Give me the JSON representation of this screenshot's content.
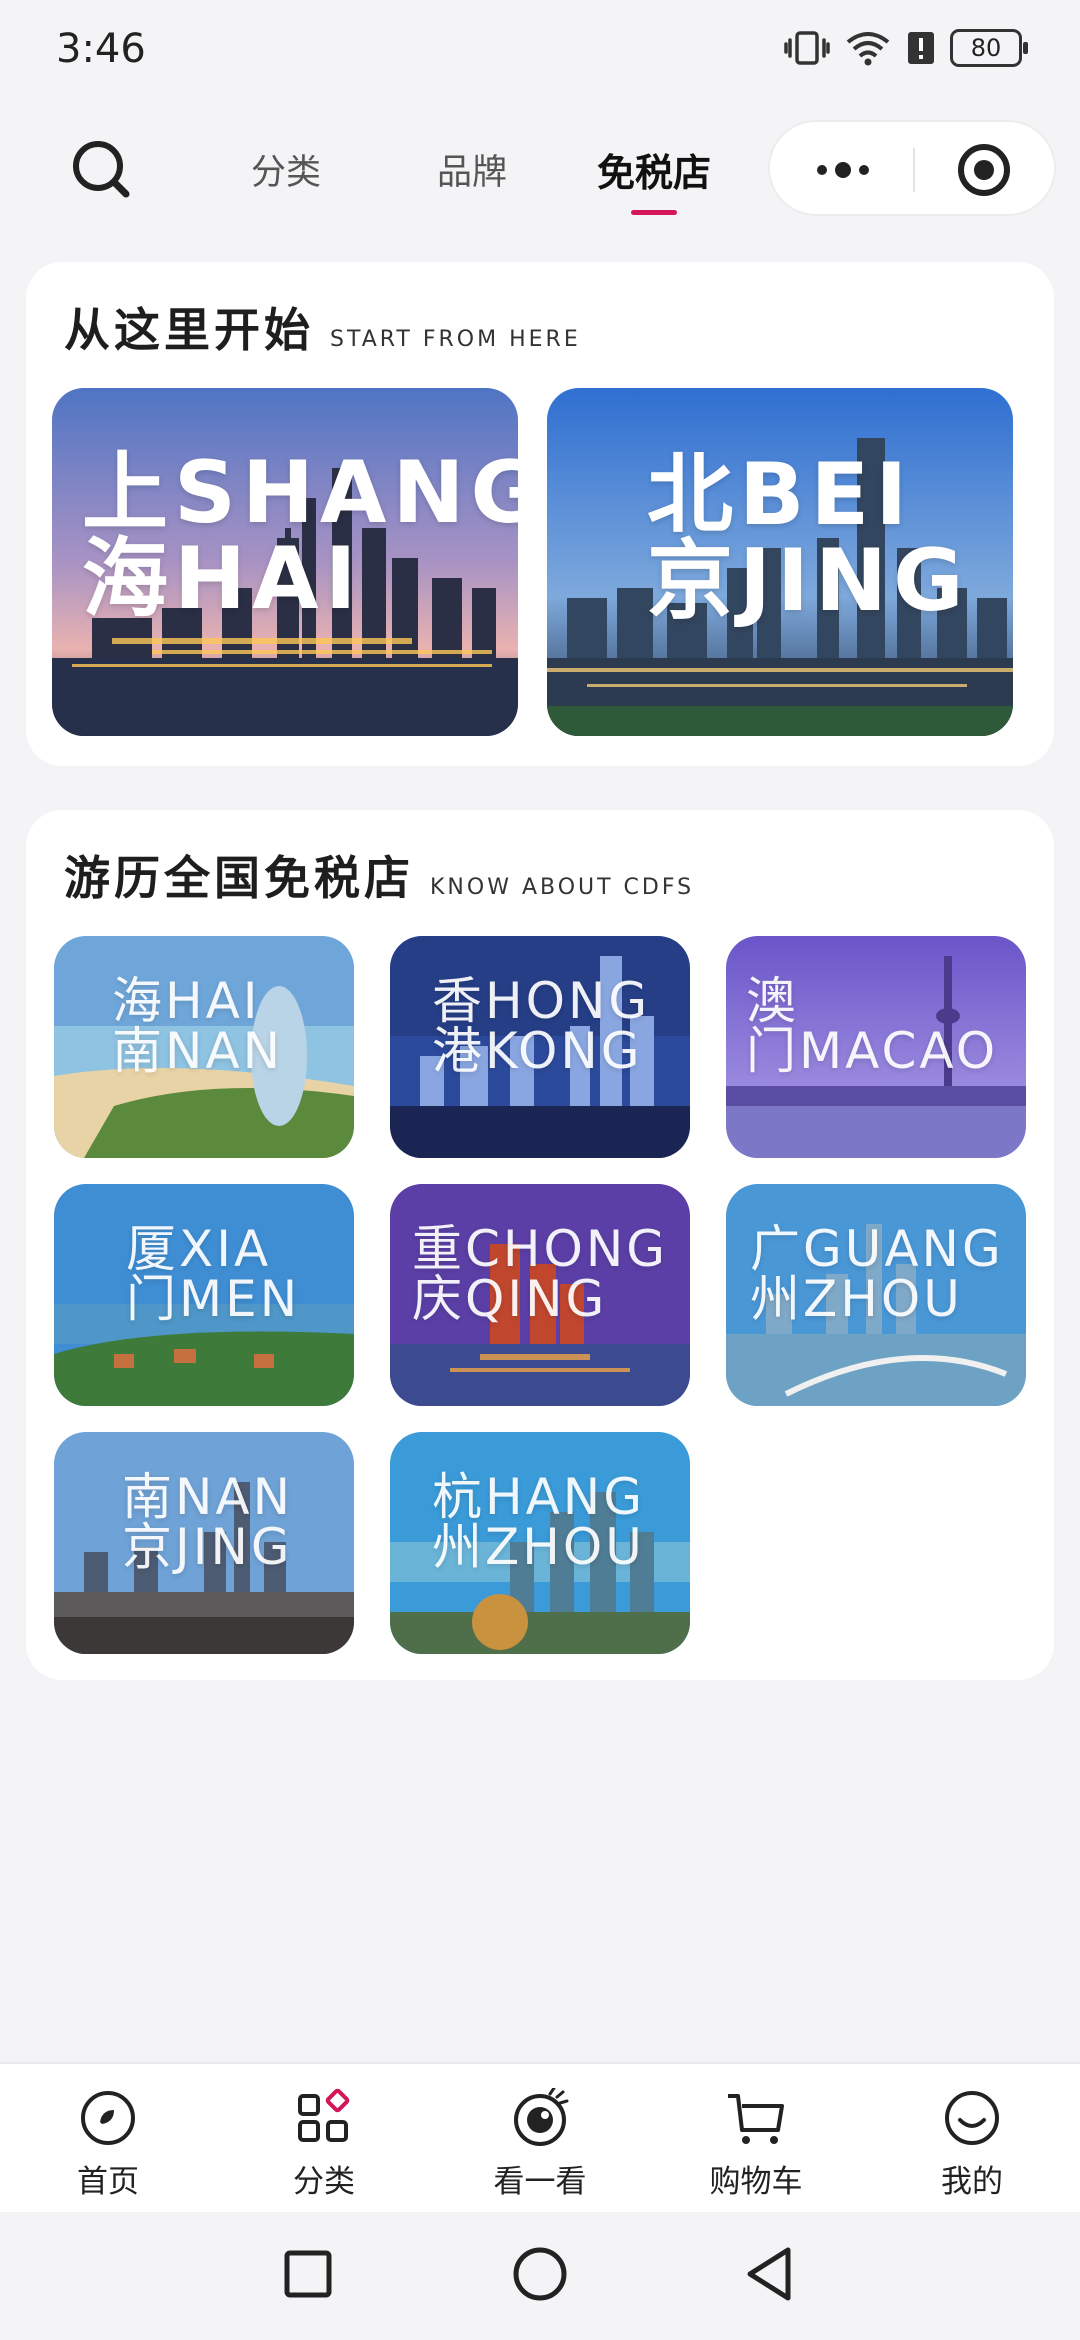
{
  "status_bar": {
    "time": "3:46",
    "battery": "80"
  },
  "top_nav": {
    "tabs": [
      {
        "label": "分类",
        "active": false
      },
      {
        "label": "品牌",
        "active": false
      },
      {
        "label": "免税店",
        "active": true
      }
    ],
    "accent_color": "#d4155a"
  },
  "section_start": {
    "title_cn": "从这里开始",
    "title_en": "START FROM HERE",
    "cities": [
      {
        "cn": [
          "上",
          "海"
        ],
        "en": [
          "SHANG",
          "HAI"
        ]
      },
      {
        "cn": [
          "北",
          "京"
        ],
        "en": [
          "BEI",
          "JING"
        ]
      }
    ]
  },
  "section_cdfs": {
    "title_cn": "游历全国免税店",
    "title_en": "KNOW ABOUT CDFS",
    "stores": [
      {
        "line1": "海HAI",
        "line2": "南NAN"
      },
      {
        "line1": "香HONG",
        "line2": "港KONG"
      },
      {
        "line1": "澳",
        "line2": "门MACAO"
      },
      {
        "line1": "厦XIA",
        "line2": "门MEN"
      },
      {
        "line1": "重CHONG",
        "line2": "庆QING"
      },
      {
        "line1": "广GUANG",
        "line2": "州ZHOU"
      },
      {
        "line1": "南NAN",
        "line2": "京JING"
      },
      {
        "line1": "杭HANG",
        "line2": "州ZHOU"
      }
    ]
  },
  "bottom_nav": {
    "items": [
      {
        "label": "首页",
        "icon": "home-icon"
      },
      {
        "label": "分类",
        "icon": "category-icon"
      },
      {
        "label": "看一看",
        "icon": "eye-icon"
      },
      {
        "label": "购物车",
        "icon": "cart-icon"
      },
      {
        "label": "我的",
        "icon": "smile-icon"
      }
    ]
  }
}
